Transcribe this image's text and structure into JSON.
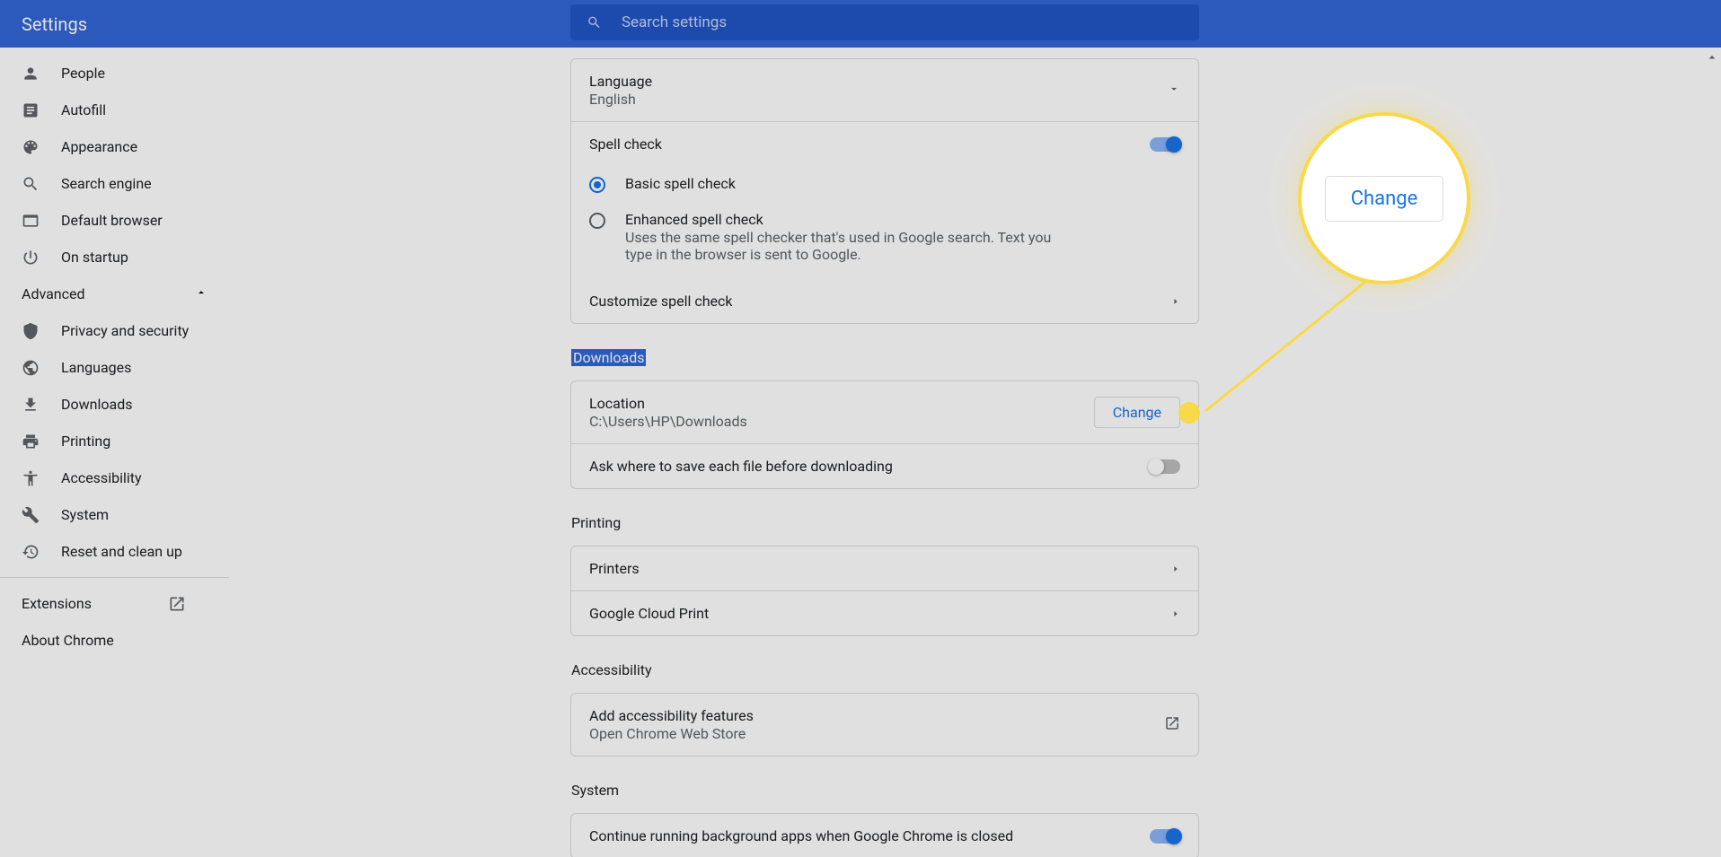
{
  "header": {
    "title": "Settings",
    "search_placeholder": "Search settings"
  },
  "sidebar": {
    "items": [
      {
        "label": "People",
        "icon": "person"
      },
      {
        "label": "Autofill",
        "icon": "autofill"
      },
      {
        "label": "Appearance",
        "icon": "palette"
      },
      {
        "label": "Search engine",
        "icon": "search"
      },
      {
        "label": "Default browser",
        "icon": "browser"
      },
      {
        "label": "On startup",
        "icon": "power"
      }
    ],
    "advanced_label": "Advanced",
    "advanced_items": [
      {
        "label": "Privacy and security",
        "icon": "shield"
      },
      {
        "label": "Languages",
        "icon": "globe"
      },
      {
        "label": "Downloads",
        "icon": "download"
      },
      {
        "label": "Printing",
        "icon": "print"
      },
      {
        "label": "Accessibility",
        "icon": "accessibility"
      },
      {
        "label": "System",
        "icon": "wrench"
      },
      {
        "label": "Reset and clean up",
        "icon": "restore"
      }
    ],
    "extensions_label": "Extensions",
    "about_label": "About Chrome"
  },
  "languages_section": {
    "language_label": "Language",
    "language_value": "English",
    "spell_check_label": "Spell check",
    "spell_check_on": true,
    "basic_label": "Basic spell check",
    "enhanced_label": "Enhanced spell check",
    "enhanced_desc": "Uses the same spell checker that's used in Google search. Text you type in the browser is sent to Google.",
    "customize_label": "Customize spell check"
  },
  "downloads_section": {
    "title": "Downloads",
    "location_label": "Location",
    "location_value": "C:\\Users\\HP\\Downloads",
    "change_label": "Change",
    "ask_label": "Ask where to save each file before downloading",
    "ask_on": false
  },
  "printing_section": {
    "title": "Printing",
    "printers_label": "Printers",
    "cloud_print_label": "Google Cloud Print"
  },
  "accessibility_section": {
    "title": "Accessibility",
    "add_label": "Add accessibility features",
    "add_sublabel": "Open Chrome Web Store"
  },
  "system_section": {
    "title": "System",
    "continue_label": "Continue running background apps when Google Chrome is closed",
    "continue_on": true
  },
  "callout": {
    "button_label": "Change"
  }
}
